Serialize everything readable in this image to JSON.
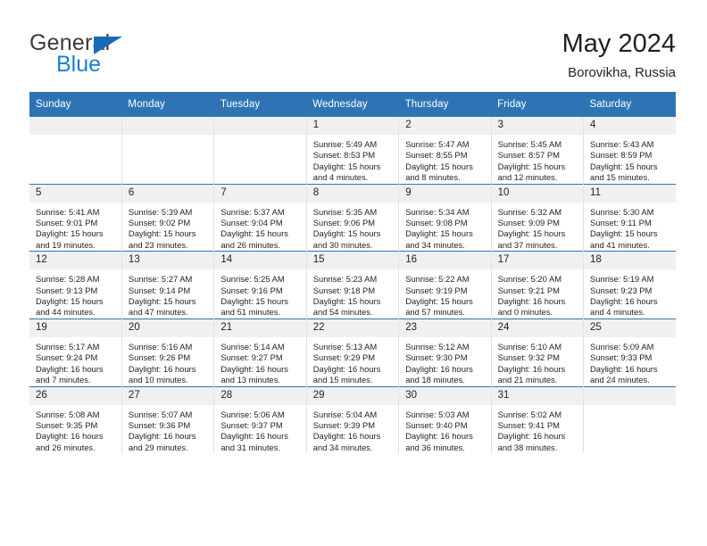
{
  "brand": {
    "name_top": "General",
    "name_bottom": "Blue",
    "triangle_color": "#1a6bb5",
    "blue_color": "#1a7fd4"
  },
  "header": {
    "title": "May 2024",
    "subtitle": "Borovikha, Russia"
  },
  "theme": {
    "header_blue": "#2e74b5",
    "daynum_band": "#f0f0f0",
    "cell_border": "#e2e2e2",
    "text": "#231f20"
  },
  "columns": [
    "Sunday",
    "Monday",
    "Tuesday",
    "Wednesday",
    "Thursday",
    "Friday",
    "Saturday"
  ],
  "labels": {
    "sunrise": "Sunrise:",
    "sunset": "Sunset:",
    "daylight": "Daylight:"
  },
  "weeks": [
    [
      {
        "day": "",
        "empty": true
      },
      {
        "day": "",
        "empty": true
      },
      {
        "day": "",
        "empty": true
      },
      {
        "day": "1",
        "sunrise": "Sunrise: 5:49 AM",
        "sunset": "Sunset: 8:53 PM",
        "daylight1": "Daylight: 15 hours",
        "daylight2": "and 4 minutes."
      },
      {
        "day": "2",
        "sunrise": "Sunrise: 5:47 AM",
        "sunset": "Sunset: 8:55 PM",
        "daylight1": "Daylight: 15 hours",
        "daylight2": "and 8 minutes."
      },
      {
        "day": "3",
        "sunrise": "Sunrise: 5:45 AM",
        "sunset": "Sunset: 8:57 PM",
        "daylight1": "Daylight: 15 hours",
        "daylight2": "and 12 minutes."
      },
      {
        "day": "4",
        "sunrise": "Sunrise: 5:43 AM",
        "sunset": "Sunset: 8:59 PM",
        "daylight1": "Daylight: 15 hours",
        "daylight2": "and 15 minutes."
      }
    ],
    [
      {
        "day": "5",
        "sunrise": "Sunrise: 5:41 AM",
        "sunset": "Sunset: 9:01 PM",
        "daylight1": "Daylight: 15 hours",
        "daylight2": "and 19 minutes."
      },
      {
        "day": "6",
        "sunrise": "Sunrise: 5:39 AM",
        "sunset": "Sunset: 9:02 PM",
        "daylight1": "Daylight: 15 hours",
        "daylight2": "and 23 minutes."
      },
      {
        "day": "7",
        "sunrise": "Sunrise: 5:37 AM",
        "sunset": "Sunset: 9:04 PM",
        "daylight1": "Daylight: 15 hours",
        "daylight2": "and 26 minutes."
      },
      {
        "day": "8",
        "sunrise": "Sunrise: 5:35 AM",
        "sunset": "Sunset: 9:06 PM",
        "daylight1": "Daylight: 15 hours",
        "daylight2": "and 30 minutes."
      },
      {
        "day": "9",
        "sunrise": "Sunrise: 5:34 AM",
        "sunset": "Sunset: 9:08 PM",
        "daylight1": "Daylight: 15 hours",
        "daylight2": "and 34 minutes."
      },
      {
        "day": "10",
        "sunrise": "Sunrise: 5:32 AM",
        "sunset": "Sunset: 9:09 PM",
        "daylight1": "Daylight: 15 hours",
        "daylight2": "and 37 minutes."
      },
      {
        "day": "11",
        "sunrise": "Sunrise: 5:30 AM",
        "sunset": "Sunset: 9:11 PM",
        "daylight1": "Daylight: 15 hours",
        "daylight2": "and 41 minutes."
      }
    ],
    [
      {
        "day": "12",
        "sunrise": "Sunrise: 5:28 AM",
        "sunset": "Sunset: 9:13 PM",
        "daylight1": "Daylight: 15 hours",
        "daylight2": "and 44 minutes."
      },
      {
        "day": "13",
        "sunrise": "Sunrise: 5:27 AM",
        "sunset": "Sunset: 9:14 PM",
        "daylight1": "Daylight: 15 hours",
        "daylight2": "and 47 minutes."
      },
      {
        "day": "14",
        "sunrise": "Sunrise: 5:25 AM",
        "sunset": "Sunset: 9:16 PM",
        "daylight1": "Daylight: 15 hours",
        "daylight2": "and 51 minutes."
      },
      {
        "day": "15",
        "sunrise": "Sunrise: 5:23 AM",
        "sunset": "Sunset: 9:18 PM",
        "daylight1": "Daylight: 15 hours",
        "daylight2": "and 54 minutes."
      },
      {
        "day": "16",
        "sunrise": "Sunrise: 5:22 AM",
        "sunset": "Sunset: 9:19 PM",
        "daylight1": "Daylight: 15 hours",
        "daylight2": "and 57 minutes."
      },
      {
        "day": "17",
        "sunrise": "Sunrise: 5:20 AM",
        "sunset": "Sunset: 9:21 PM",
        "daylight1": "Daylight: 16 hours",
        "daylight2": "and 0 minutes."
      },
      {
        "day": "18",
        "sunrise": "Sunrise: 5:19 AM",
        "sunset": "Sunset: 9:23 PM",
        "daylight1": "Daylight: 16 hours",
        "daylight2": "and 4 minutes."
      }
    ],
    [
      {
        "day": "19",
        "sunrise": "Sunrise: 5:17 AM",
        "sunset": "Sunset: 9:24 PM",
        "daylight1": "Daylight: 16 hours",
        "daylight2": "and 7 minutes."
      },
      {
        "day": "20",
        "sunrise": "Sunrise: 5:16 AM",
        "sunset": "Sunset: 9:26 PM",
        "daylight1": "Daylight: 16 hours",
        "daylight2": "and 10 minutes."
      },
      {
        "day": "21",
        "sunrise": "Sunrise: 5:14 AM",
        "sunset": "Sunset: 9:27 PM",
        "daylight1": "Daylight: 16 hours",
        "daylight2": "and 13 minutes."
      },
      {
        "day": "22",
        "sunrise": "Sunrise: 5:13 AM",
        "sunset": "Sunset: 9:29 PM",
        "daylight1": "Daylight: 16 hours",
        "daylight2": "and 15 minutes."
      },
      {
        "day": "23",
        "sunrise": "Sunrise: 5:12 AM",
        "sunset": "Sunset: 9:30 PM",
        "daylight1": "Daylight: 16 hours",
        "daylight2": "and 18 minutes."
      },
      {
        "day": "24",
        "sunrise": "Sunrise: 5:10 AM",
        "sunset": "Sunset: 9:32 PM",
        "daylight1": "Daylight: 16 hours",
        "daylight2": "and 21 minutes."
      },
      {
        "day": "25",
        "sunrise": "Sunrise: 5:09 AM",
        "sunset": "Sunset: 9:33 PM",
        "daylight1": "Daylight: 16 hours",
        "daylight2": "and 24 minutes."
      }
    ],
    [
      {
        "day": "26",
        "sunrise": "Sunrise: 5:08 AM",
        "sunset": "Sunset: 9:35 PM",
        "daylight1": "Daylight: 16 hours",
        "daylight2": "and 26 minutes."
      },
      {
        "day": "27",
        "sunrise": "Sunrise: 5:07 AM",
        "sunset": "Sunset: 9:36 PM",
        "daylight1": "Daylight: 16 hours",
        "daylight2": "and 29 minutes."
      },
      {
        "day": "28",
        "sunrise": "Sunrise: 5:06 AM",
        "sunset": "Sunset: 9:37 PM",
        "daylight1": "Daylight: 16 hours",
        "daylight2": "and 31 minutes."
      },
      {
        "day": "29",
        "sunrise": "Sunrise: 5:04 AM",
        "sunset": "Sunset: 9:39 PM",
        "daylight1": "Daylight: 16 hours",
        "daylight2": "and 34 minutes."
      },
      {
        "day": "30",
        "sunrise": "Sunrise: 5:03 AM",
        "sunset": "Sunset: 9:40 PM",
        "daylight1": "Daylight: 16 hours",
        "daylight2": "and 36 minutes."
      },
      {
        "day": "31",
        "sunrise": "Sunrise: 5:02 AM",
        "sunset": "Sunset: 9:41 PM",
        "daylight1": "Daylight: 16 hours",
        "daylight2": "and 38 minutes."
      },
      {
        "day": "",
        "empty": true
      }
    ]
  ]
}
